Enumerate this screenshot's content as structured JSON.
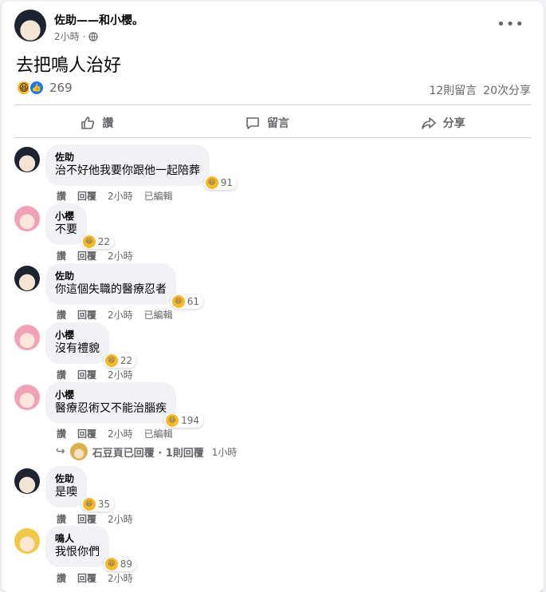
{
  "post": {
    "author": "佐助——和小櫻。",
    "time": "2小時",
    "privacy_icon": "globe-icon",
    "more_label": "•••",
    "text": "去把鳴人治好",
    "reaction_count": "269",
    "comments_count": "12則留言",
    "shares_count": "20次分享"
  },
  "actions": {
    "like": "讚",
    "comment": "留言",
    "share": "分享"
  },
  "comments": [
    {
      "name": "佐助",
      "text": "治不好他我要你跟他一起陪葬",
      "reactions": "91",
      "like": "讚",
      "reply": "回覆",
      "time": "2小時",
      "edited": "已編輯"
    },
    {
      "name": "小櫻",
      "text": "不要",
      "reactions": "22",
      "like": "讚",
      "reply": "回覆",
      "time": "2小時"
    },
    {
      "name": "佐助",
      "text": "你這個失職的醫療忍者",
      "reactions": "61",
      "like": "讚",
      "reply": "回覆",
      "time": "2小時",
      "edited": "已編輯"
    },
    {
      "name": "小櫻",
      "text": "沒有禮貌",
      "reactions": "22",
      "like": "讚",
      "reply": "回覆",
      "time": "2小時"
    },
    {
      "name": "小櫻",
      "text": "醫療忍術又不能治腦疾",
      "reactions": "194",
      "like": "讚",
      "reply": "回覆",
      "time": "2小時",
      "edited": "已編輯"
    },
    {
      "name": "佐助",
      "text": "是噢",
      "reactions": "35",
      "like": "讚",
      "reply": "回覆",
      "time": "2小時"
    },
    {
      "name": "鳴人",
      "text": "我恨你們",
      "reactions": "89",
      "like": "讚",
      "reply": "回覆",
      "time": "2小時"
    }
  ],
  "reply_summary": {
    "text": "石豆頁已回覆 · 1則回覆",
    "time": "1小時"
  },
  "colors": {
    "secondary_text": "#65676b",
    "bubble_bg": "#f0f2f5",
    "haha_yellow": "#f7b928",
    "like_blue": "#1877f2"
  }
}
